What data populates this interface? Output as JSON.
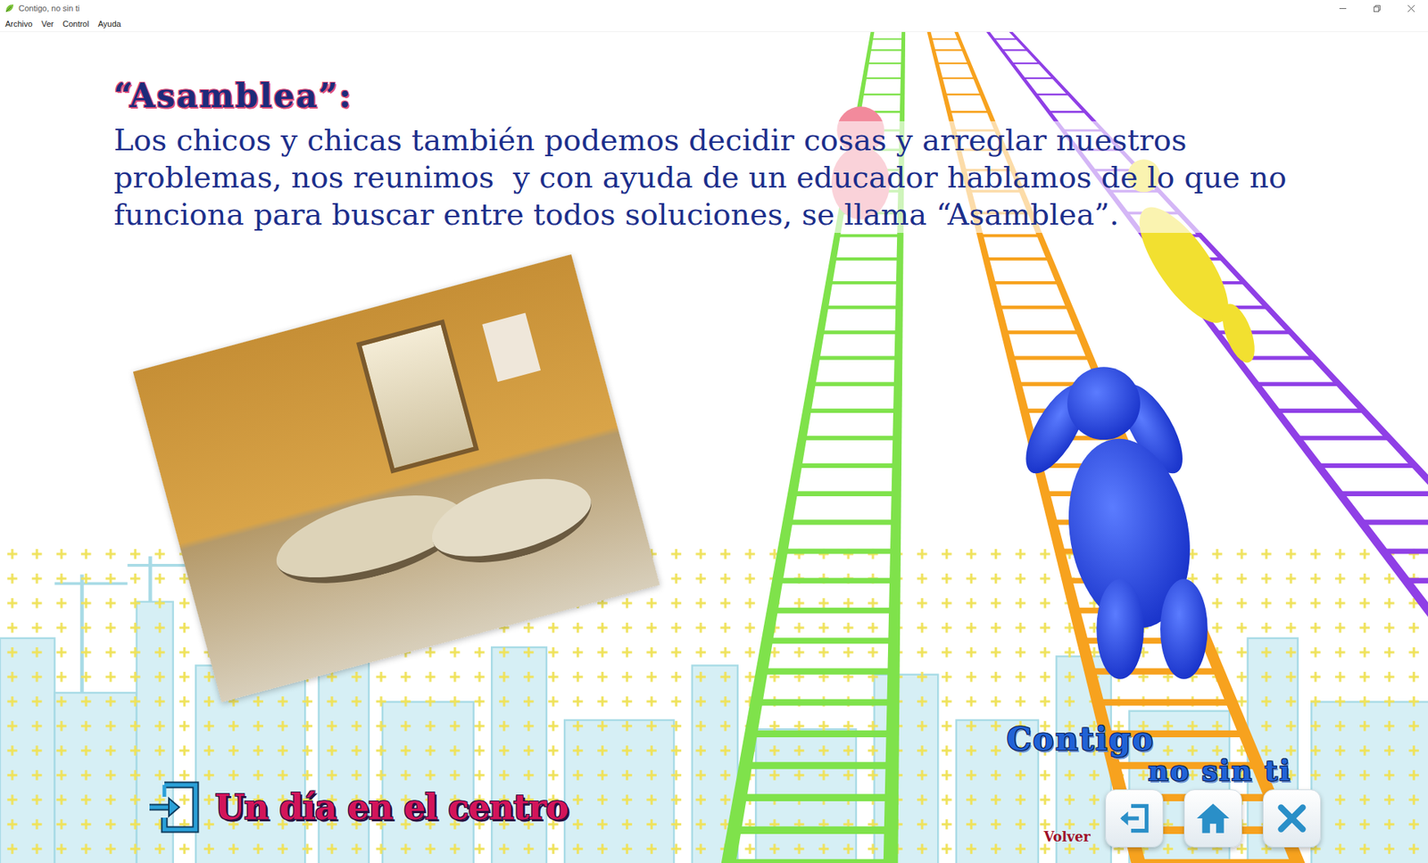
{
  "window": {
    "title": "Contigo, no sin ti",
    "controls": [
      {
        "kind": "minimize"
      },
      {
        "kind": "restore"
      },
      {
        "kind": "close"
      }
    ]
  },
  "menu": [
    {
      "label": "Archivo"
    },
    {
      "label": "Ver"
    },
    {
      "label": "Control"
    },
    {
      "label": "Ayuda"
    }
  ],
  "heading": "“Asamblea”:",
  "body": "Los chicos y chicas también podemos decidir cosas y arreglar nuestros problemas, nos reunimos  y con ayuda de un educador hablamos de lo que no funciona para buscar entre todos soluciones, se llama “Asamblea”.",
  "link": {
    "label": "Un día en el centro"
  },
  "logo": {
    "line1": "Contigo",
    "line2": "no sin ti"
  },
  "nav": {
    "label": "Volver",
    "buttons": [
      {
        "kind": "back"
      },
      {
        "kind": "home"
      },
      {
        "kind": "close"
      }
    ]
  }
}
